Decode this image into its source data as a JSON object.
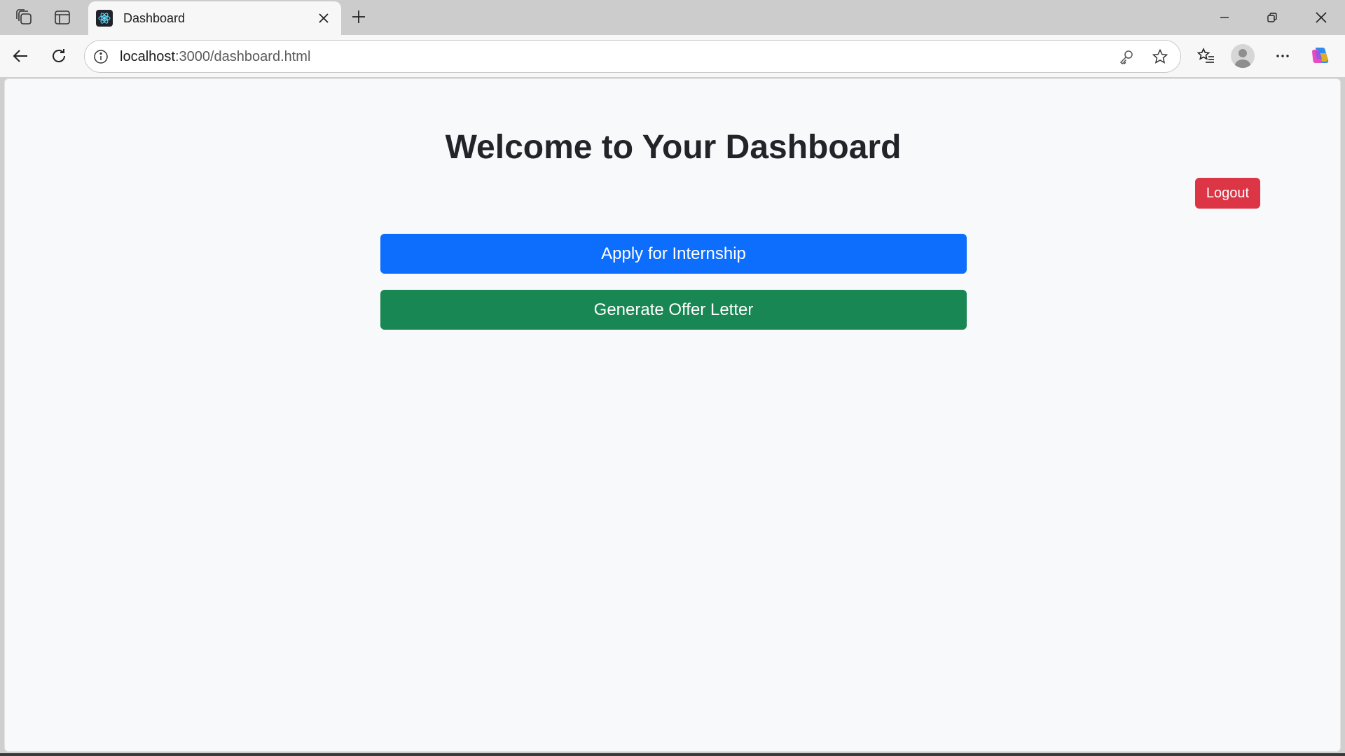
{
  "browser": {
    "tab": {
      "title": "Dashboard",
      "favicon": "react-atom-icon"
    },
    "address_bar": {
      "host": "localhost",
      "rest": ":3000/dashboard.html"
    },
    "icons": {
      "workspaces": "workspaces-icon",
      "tab_actions": "vertical-tabs-icon",
      "close_tab": "close-icon",
      "new_tab": "plus-icon",
      "back": "back-arrow-icon",
      "refresh": "refresh-icon",
      "site_info": "info-icon",
      "password": "key-icon",
      "favorite": "star-icon",
      "favorites": "favorites-list-icon",
      "profile": "profile-avatar-icon",
      "menu": "more-icon",
      "copilot": "copilot-icon"
    }
  },
  "page": {
    "title": "Welcome to Your Dashboard",
    "logout_label": "Logout",
    "apply_label": "Apply for Internship",
    "offer_label": "Generate Offer Letter"
  },
  "colors": {
    "logout": "#dc3545",
    "apply": "#0d6efd",
    "offer": "#198754",
    "background": "#f8f9fa"
  }
}
